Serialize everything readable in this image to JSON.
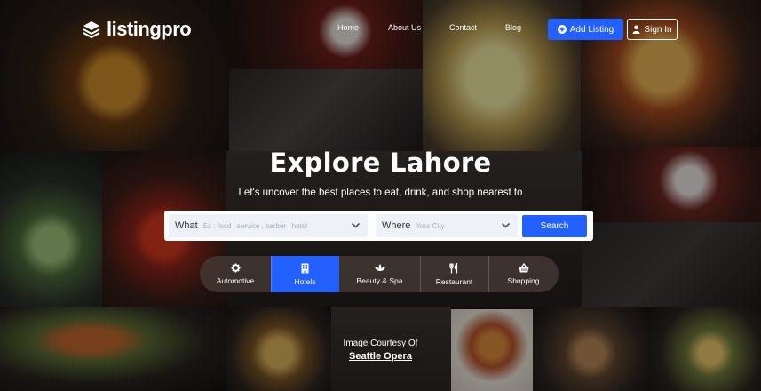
{
  "brand": {
    "logo_text": "listingpro"
  },
  "nav": {
    "items": [
      "Home",
      "About Us",
      "Contact",
      "Blog"
    ]
  },
  "header": {
    "add_listing": "Add Listing",
    "sign_in": "Sign In"
  },
  "hero": {
    "title": "Explore Lahore",
    "subtitle": "Let's uncover the best places to eat, drink, and shop nearest to"
  },
  "search": {
    "what_label": "What",
    "what_placeholder": "Ex : food , service , barber , hotel",
    "where_label": "Where",
    "where_placeholder": "Your City",
    "button": "Search"
  },
  "categories": [
    {
      "label": "Automotive",
      "icon": "gear-icon",
      "active": false
    },
    {
      "label": "Hotels",
      "icon": "building-icon",
      "active": true
    },
    {
      "label": "Beauty & Spa",
      "icon": "lotus-icon",
      "active": false
    },
    {
      "label": "Restaurant",
      "icon": "utensils-icon",
      "active": false
    },
    {
      "label": "Shopping",
      "icon": "basket-icon",
      "active": false
    }
  ],
  "courtesy": {
    "prefix": "Image Courtesy Of",
    "name": "Seattle Opera"
  },
  "colors": {
    "accent": "#2261ff",
    "white": "#ffffff"
  }
}
